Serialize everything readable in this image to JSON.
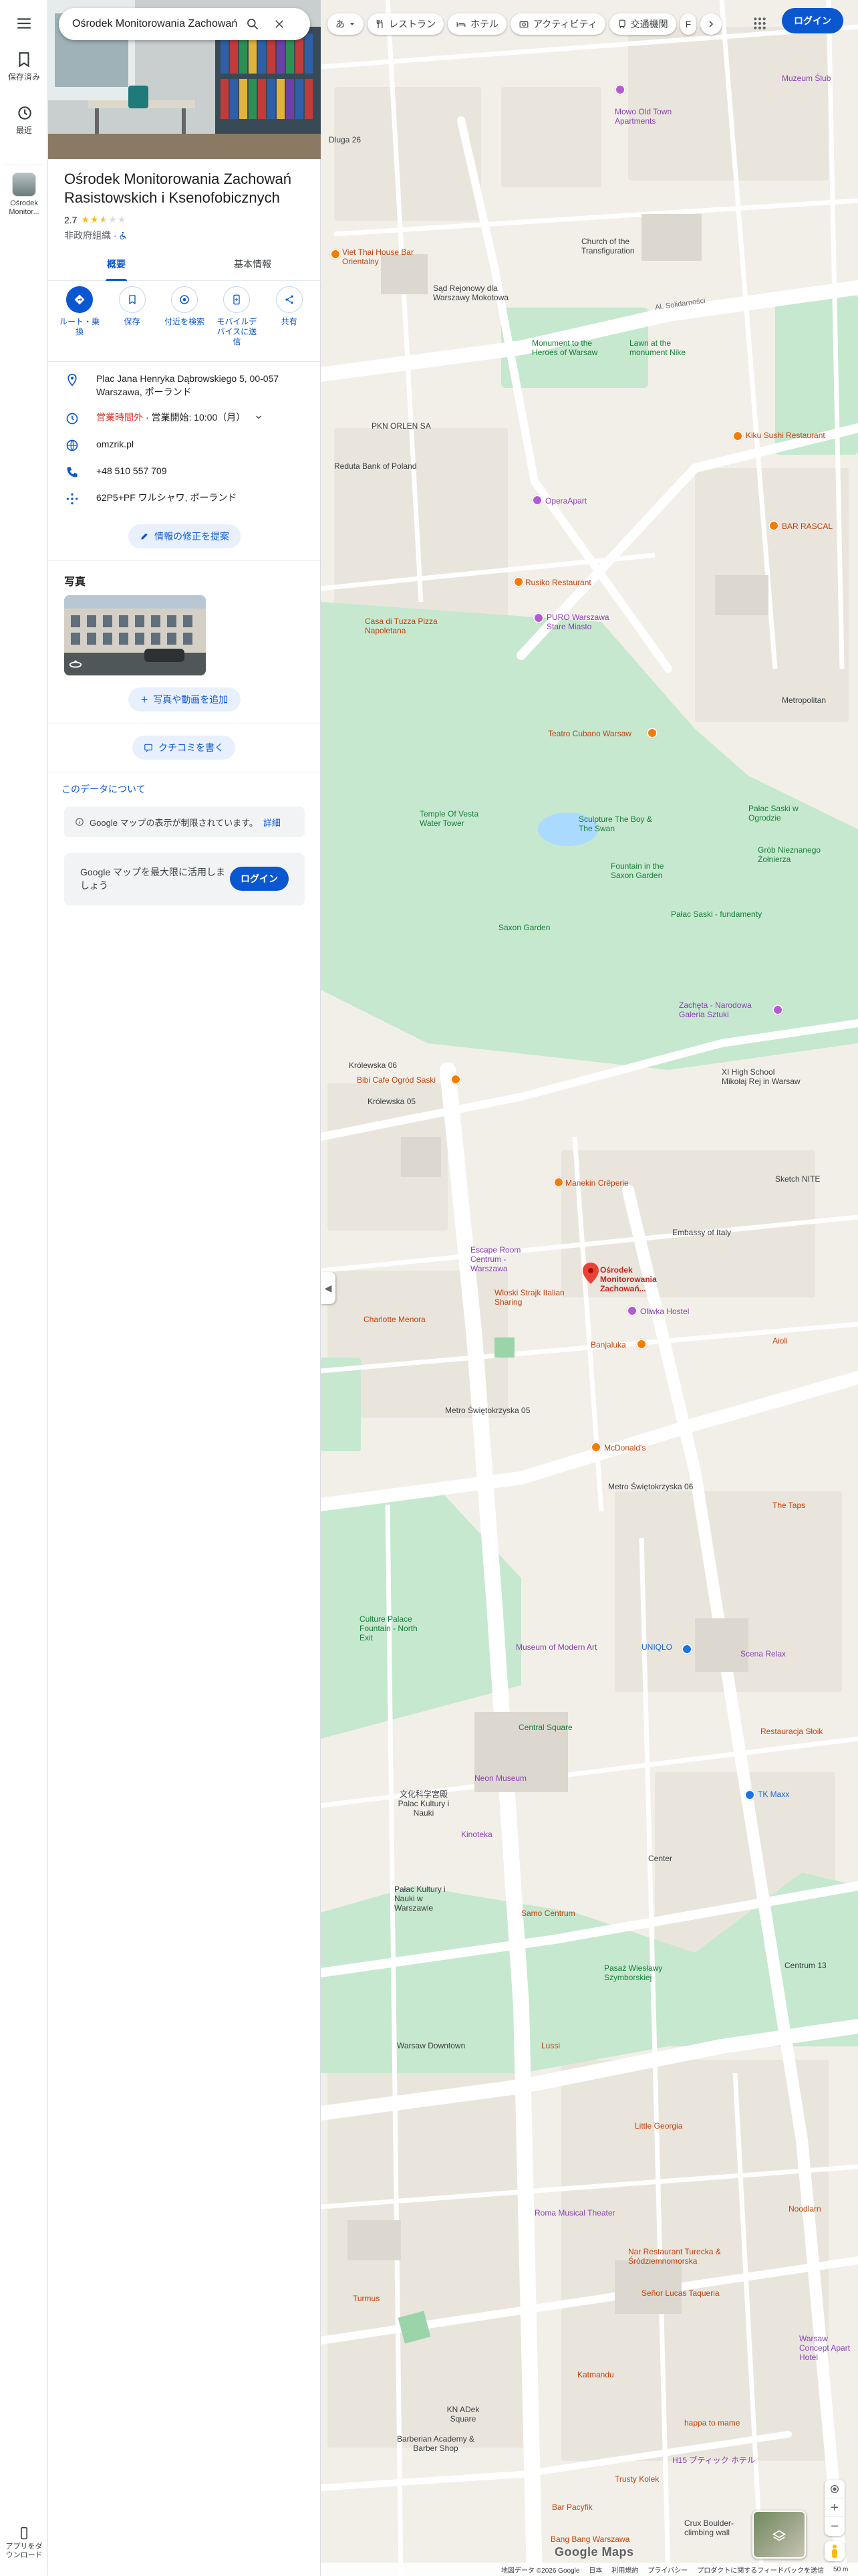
{
  "search": {
    "value": "Ośrodek Monitorowania Zachowań R"
  },
  "rail": {
    "saved": "保存済み",
    "recent": "最近",
    "place_short": "Ośrodek Monitor...",
    "get_app": "アプリをダウンロード"
  },
  "place": {
    "title": "Ośrodek Monitorowania Zachowań Rasistowskich i Ksenofobicznych",
    "rating": "2.7",
    "stars_filled": 2.5,
    "category": "非政府組織 · ",
    "accessibility_icon": "wheelchair-icon"
  },
  "tabs": [
    {
      "label": "概要"
    },
    {
      "label": "基本情報"
    }
  ],
  "actions": [
    {
      "label": "ルート・乗換",
      "icon": "directions-icon"
    },
    {
      "label": "保存",
      "icon": "bookmark-icon"
    },
    {
      "label": "付近を検索",
      "icon": "nearby-icon"
    },
    {
      "label": "モバイルデバイスに送信",
      "icon": "send-to-phone-icon"
    },
    {
      "label": "共有",
      "icon": "share-icon"
    }
  ],
  "info": {
    "address": "Plac Jana Henryka Dąbrowskiego 5, 00-057 Warszawa, ポーランド",
    "hours_status": "営業時間外",
    "hours_next": " · 営業開始: 10:00（月）",
    "website": "omzrik.pl",
    "phone": "+48 510 557 709",
    "plus_code": "62P5+PF ワルシャワ, ポーランド"
  },
  "buttons": {
    "suggest_edit": "情報の修正を提案",
    "add_photo": "写真や動画を追加",
    "write_review": "クチコミを書く",
    "login": "ログイン"
  },
  "photos": {
    "heading": "写真"
  },
  "about_data": "このデータについて",
  "notice": {
    "text": "Google マップの表示が制限されています。",
    "link": "詳細"
  },
  "login_card": {
    "text": "Google マップを最大限に活用しましょう"
  },
  "chips": [
    {
      "label": "あ",
      "icon": "input-tools-icon"
    },
    {
      "label": "レストラン",
      "icon": "restaurant-icon"
    },
    {
      "label": "ホテル",
      "icon": "hotel-icon"
    },
    {
      "label": "アクティビティ",
      "icon": "camera-icon"
    },
    {
      "label": "交通機関",
      "icon": "transit-icon"
    },
    {
      "label": "F",
      "icon": "pharmacy-icon"
    }
  ],
  "map": {
    "labels": [
      {
        "t": "Mowo Old Town Apartments",
        "c": "poi-purple"
      },
      {
        "t": "Muzeum Ślub",
        "c": "poi-purple"
      },
      {
        "t": "Dluga 26",
        "c": "poi-gray"
      },
      {
        "t": "Church of the Transfiguration",
        "c": "poi-gray"
      },
      {
        "t": "Viet Thai House Bar Orientalny",
        "c": "poi-orange"
      },
      {
        "t": "Sąd Rejonowy dla Warszawy Mokotowa",
        "c": "poi-gray"
      },
      {
        "t": "Al. Solidarności",
        "c": "street"
      },
      {
        "t": "Monument to the Heroes of Warsaw",
        "c": "poi-green"
      },
      {
        "t": "Lawn at the monument Nike",
        "c": "poi-green"
      },
      {
        "t": "PKN ORLEN SA",
        "c": "poi-gray"
      },
      {
        "t": "Kiku Sushi Restaurant",
        "c": "poi-orange"
      },
      {
        "t": "Reduta Bank of Poland",
        "c": "poi-gray"
      },
      {
        "t": "OperaApart",
        "c": "poi-purple"
      },
      {
        "t": "BAR RASCAL",
        "c": "poi-orange"
      },
      {
        "t": "Rusiko Restaurant",
        "c": "poi-orange"
      },
      {
        "t": "PURO Warszawa Stare Miasto",
        "c": "poi-purple"
      },
      {
        "t": "Casa di Tuzza Pizza Napoletana",
        "c": "poi-orange"
      },
      {
        "t": "Metropolitan",
        "c": "poi-gray"
      },
      {
        "t": "Teatro Cubano Warsaw",
        "c": "poi-orange"
      },
      {
        "t": "Temple Of Vesta Water Tower",
        "c": "poi-green"
      },
      {
        "t": "Sculpture The Boy & The Swan",
        "c": "poi-green"
      },
      {
        "t": "Pałac Saski w Ogrodzie",
        "c": "poi-green"
      },
      {
        "t": "Fountain in the Saxon Garden",
        "c": "poi-green"
      },
      {
        "t": "Grób Nieznanego Żołnierza",
        "c": "poi-green"
      },
      {
        "t": "Saxon Garden",
        "c": "poi-green"
      },
      {
        "t": "Pałac Saski - fundamenty",
        "c": "poi-green"
      },
      {
        "t": "Zachęta - Narodowa Galeria Sztuki",
        "c": "poi-purple"
      },
      {
        "t": "Królewska 06",
        "c": "poi-gray"
      },
      {
        "t": "Bibi Cafe Ogród Saski",
        "c": "poi-orange"
      },
      {
        "t": "Królewska 05",
        "c": "poi-gray"
      },
      {
        "t": "XI High School Mikołaj Rej in Warsaw",
        "c": "poi-gray"
      },
      {
        "t": "Manekin Crêperie",
        "c": "poi-orange"
      },
      {
        "t": "Sketch NITE",
        "c": "poi-gray"
      },
      {
        "t": "Embassy of Italy",
        "c": "poi-gray"
      },
      {
        "t": "Escape Room Centrum - Warszawa",
        "c": "poi-purple"
      },
      {
        "t": "Ośrodek Monitorowania Zachowań...",
        "c": "poi-red"
      },
      {
        "t": "Wloski Strajk Italian Sharing",
        "c": "poi-orange"
      },
      {
        "t": "Oliwka Hostel",
        "c": "poi-purple"
      },
      {
        "t": "Charlotte Menora",
        "c": "poi-orange"
      },
      {
        "t": "Banjaluka",
        "c": "poi-orange"
      },
      {
        "t": "Aioli",
        "c": "poi-orange"
      },
      {
        "t": "Metro Świętokrzyska 05",
        "c": "poi-gray"
      },
      {
        "t": "McDonald's",
        "c": "poi-orange"
      },
      {
        "t": "Metro Świętokrzyska 06",
        "c": "poi-gray"
      },
      {
        "t": "The Taps",
        "c": "poi-orange"
      },
      {
        "t": "Culture Palace Fountain - North Exit",
        "c": "poi-green"
      },
      {
        "t": "Museum of Modern Art",
        "c": "poi-purple"
      },
      {
        "t": "UNIQLO",
        "c": "poi-blue"
      },
      {
        "t": "Scena Relax",
        "c": "poi-purple"
      },
      {
        "t": "Central Square",
        "c": "poi-green"
      },
      {
        "t": "Restauracja Słoik",
        "c": "poi-orange"
      },
      {
        "t": "Neon Museum",
        "c": "poi-purple"
      },
      {
        "t": "文化科学宮殿 Palac Kultury i Nauki",
        "c": "poi-gray"
      },
      {
        "t": "TK Maxx",
        "c": "poi-blue"
      },
      {
        "t": "Kinoteka",
        "c": "poi-purple"
      },
      {
        "t": "Center",
        "c": "poi-gray"
      },
      {
        "t": "Samo Centrum",
        "c": "poi-orange"
      },
      {
        "t": "Pałac Kultury i Nauki w Warszawie",
        "c": "poi-gray"
      },
      {
        "t": "Centrum 13",
        "c": "poi-gray"
      },
      {
        "t": "Pasaż Wiesławy Szymborskiej",
        "c": "poi-green"
      },
      {
        "t": "Warsaw Downtown",
        "c": "poi-gray"
      },
      {
        "t": "Lussi",
        "c": "poi-orange"
      },
      {
        "t": "Little Georgia",
        "c": "poi-orange"
      },
      {
        "t": "Roma Musical Theater",
        "c": "poi-purple"
      },
      {
        "t": "Noodlarn",
        "c": "poi-orange"
      },
      {
        "t": "Nar Restaurant Turecka & Śródziemnomorska",
        "c": "poi-orange"
      },
      {
        "t": "Señor Lucas Taqueria",
        "c": "poi-orange"
      },
      {
        "t": "Turmus",
        "c": "poi-orange"
      },
      {
        "t": "Warsaw Concept Apart Hotel",
        "c": "poi-purple"
      },
      {
        "t": "Katmandu",
        "c": "poi-orange"
      },
      {
        "t": "KN ADek Square",
        "c": "poi-gray"
      },
      {
        "t": "Barberian Academy & Barber Shop",
        "c": "poi-gray"
      },
      {
        "t": "happa to mame",
        "c": "poi-orange"
      },
      {
        "t": "H15 ブティック ホテル",
        "c": "poi-purple"
      },
      {
        "t": "Bar Pacyfik",
        "c": "poi-orange"
      },
      {
        "t": "Trusty Kolek",
        "c": "poi-orange"
      },
      {
        "t": "Crux Boulder-climbing wall",
        "c": "poi-gray"
      },
      {
        "t": "Bang Bang Warszawa",
        "c": "poi-orange"
      }
    ]
  },
  "footer": {
    "items": [
      "地図データ ©2026 Google",
      "日本",
      "利用規約",
      "プライバシー",
      "プロダクトに関するフィードバックを送信",
      "50 m"
    ],
    "logo": "Google Maps"
  }
}
